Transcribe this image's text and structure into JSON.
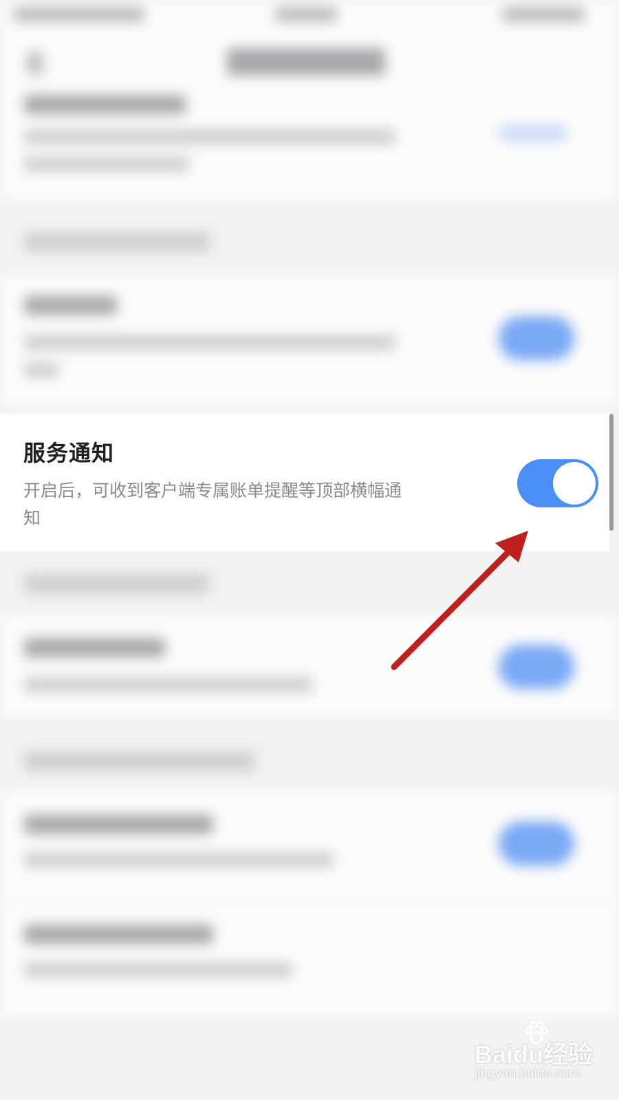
{
  "service_notice": {
    "title": "服务通知",
    "description": "开启后，可收到客户端专属账单提醒等顶部横幅通知",
    "enabled": true,
    "toggle_color": "#4a8ff5"
  },
  "annotation": {
    "arrow_color": "#c0201b",
    "arrow_icon": "red-arrow-icon"
  },
  "watermark": {
    "logo": "Baidu经验",
    "url": "jingyan.baidu.com"
  }
}
